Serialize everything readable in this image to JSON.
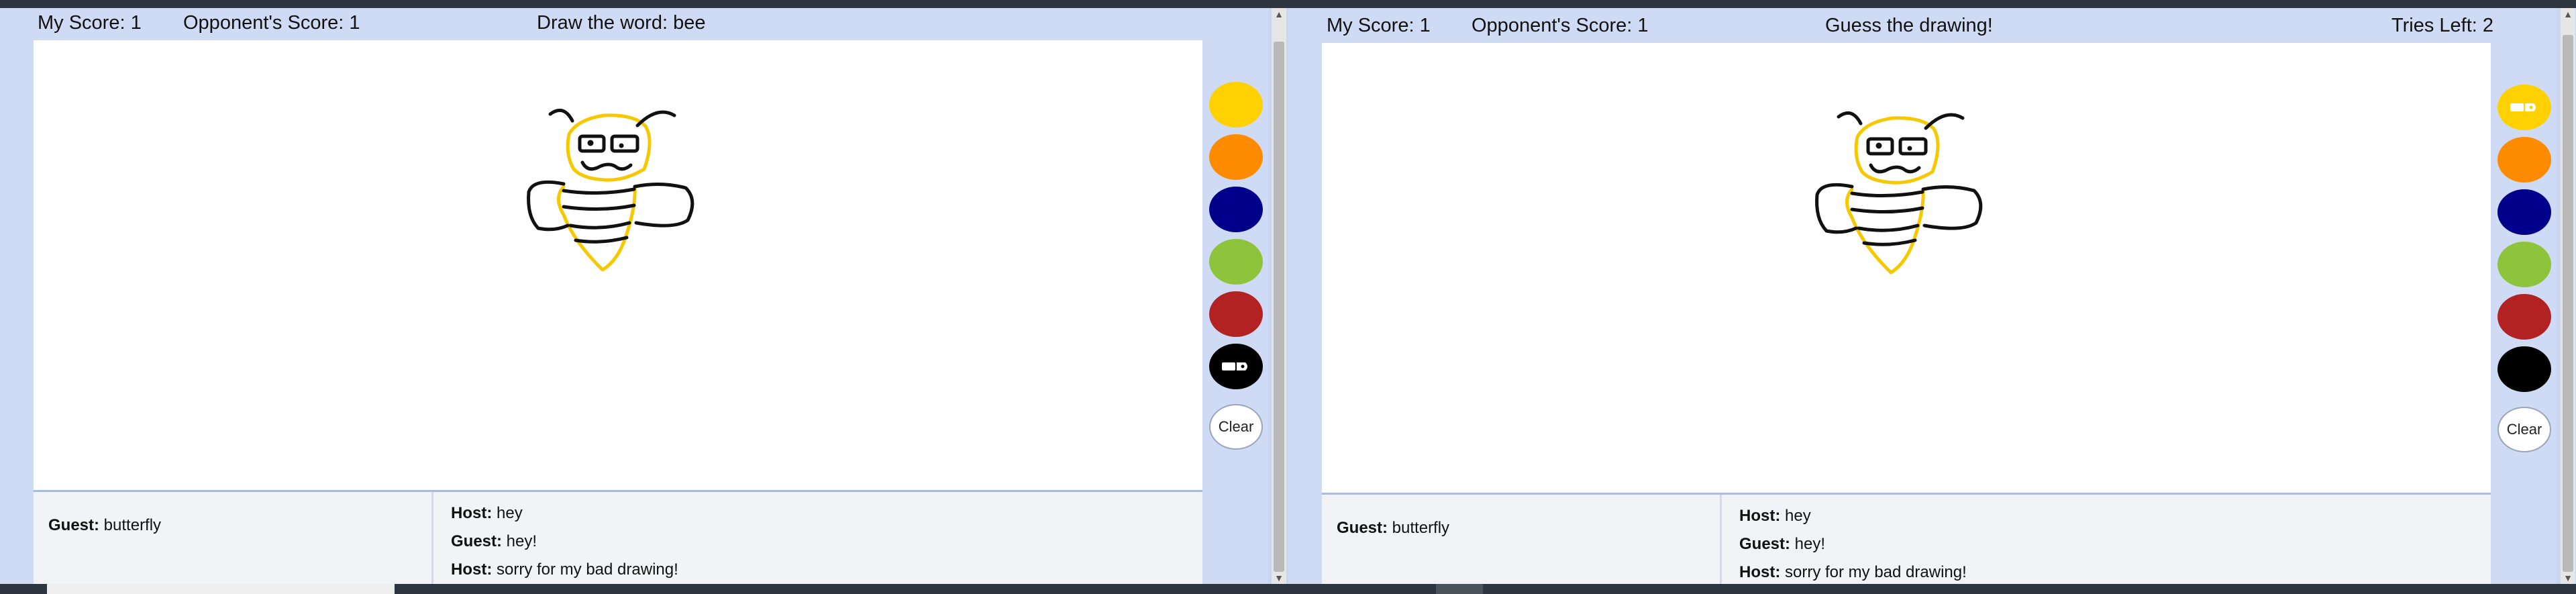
{
  "left": {
    "my_score": "My Score: 1",
    "opponent_score": "Opponent's Score: 1",
    "prompt": "Draw the word: bee",
    "guess_chat": [
      {
        "sender": "Guest:",
        "text": " butterfly"
      }
    ],
    "chat": [
      {
        "sender": "Host:",
        "text": " hey"
      },
      {
        "sender": "Guest:",
        "text": " hey!"
      },
      {
        "sender": "Host:",
        "text": " sorry for my bad drawing!"
      }
    ],
    "clear_label": "Clear"
  },
  "right": {
    "my_score": "My Score: 1",
    "opponent_score": "Opponent's Score: 1",
    "prompt": "Guess the drawing!",
    "tries_left": "Tries Left: 2",
    "guess_chat": [
      {
        "sender": "Guest:",
        "text": " butterfly"
      }
    ],
    "chat": [
      {
        "sender": "Host:",
        "text": " hey"
      },
      {
        "sender": "Guest:",
        "text": " hey!"
      },
      {
        "sender": "Host:",
        "text": " sorry for my bad drawing!"
      }
    ],
    "clear_label": "Clear"
  },
  "palette": [
    "#ffd100",
    "#ff8c00",
    "#00008b",
    "#8ec43c",
    "#b22222",
    "#000000"
  ],
  "icons": {
    "eraser": "eraser-icon",
    "scroll_up": "arrow-up-icon",
    "scroll_down": "arrow-down-icon"
  }
}
